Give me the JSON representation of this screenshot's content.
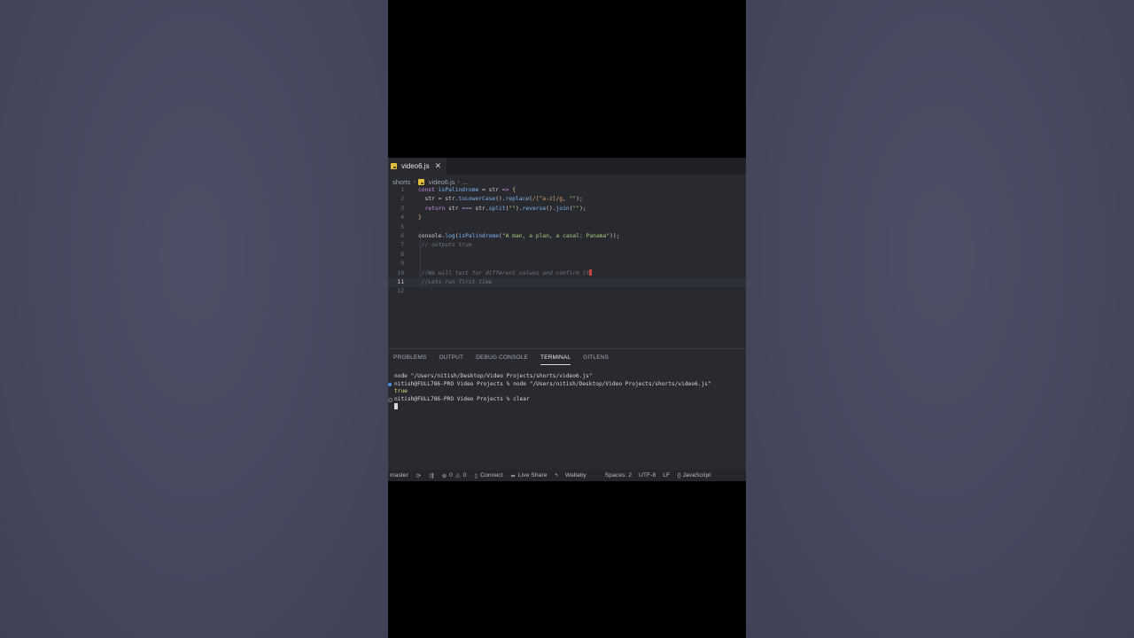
{
  "editor": {
    "tab": {
      "filename": "video6.js",
      "close_glyph": "✕"
    },
    "breadcrumb": [
      "shorts",
      "video6.js",
      "..."
    ],
    "lines": [
      {
        "n": "1",
        "segments": [
          [
            "kw",
            "const "
          ],
          [
            "fn",
            "isPalindrome"
          ],
          [
            "op",
            " = str "
          ],
          [
            "kw",
            "=>"
          ],
          [
            "op",
            " "
          ],
          [
            "brace",
            "{"
          ]
        ]
      },
      {
        "n": "2",
        "segments": [
          [
            "op",
            "  str = str."
          ],
          [
            "fn",
            "toLowerCase"
          ],
          [
            "op",
            "()."
          ],
          [
            "fn",
            "replace"
          ],
          [
            "op",
            "("
          ],
          [
            "rx",
            "/[^a-z]/g"
          ],
          [
            "op",
            ", "
          ],
          [
            "str",
            "\"\""
          ],
          [
            "op",
            ");"
          ]
        ]
      },
      {
        "n": "3",
        "segments": [
          [
            "kw",
            "  return "
          ],
          [
            "op",
            "str "
          ],
          [
            "kw",
            "==="
          ],
          [
            "op",
            " str."
          ],
          [
            "fn",
            "split"
          ],
          [
            "op",
            "("
          ],
          [
            "str",
            "\"\""
          ],
          [
            "op",
            ")."
          ],
          [
            "fn",
            "reverse"
          ],
          [
            "op",
            "()."
          ],
          [
            "fn",
            "join"
          ],
          [
            "op",
            "("
          ],
          [
            "str",
            "\"\""
          ],
          [
            "op",
            ");"
          ]
        ]
      },
      {
        "n": "4",
        "segments": [
          [
            "brace",
            "}"
          ]
        ]
      },
      {
        "n": "5",
        "segments": []
      },
      {
        "n": "6",
        "segments": [
          [
            "op",
            "console."
          ],
          [
            "fn",
            "log"
          ],
          [
            "op",
            "("
          ],
          [
            "fn",
            "isPalindrome"
          ],
          [
            "op",
            "("
          ],
          [
            "str",
            "\"A man, a plan, a canal: Panama\""
          ],
          [
            "op",
            "));"
          ]
        ]
      },
      {
        "n": "7",
        "segments": [
          [
            "cm",
            " // outputs true"
          ]
        ]
      },
      {
        "n": "8",
        "segments": []
      },
      {
        "n": "9",
        "segments": []
      },
      {
        "n": "10",
        "segments": [
          [
            "cm",
            " //We will test for different values and confirm it"
          ]
        ]
      },
      {
        "n": "11",
        "segments": [
          [
            "cm",
            " //Lets run first time"
          ]
        ]
      },
      {
        "n": "12",
        "segments": []
      }
    ],
    "active_line": "11"
  },
  "panel": {
    "tabs": [
      "PROBLEMS",
      "OUTPUT",
      "DEBUG CONSOLE",
      "TERMINAL",
      "GITLENS"
    ],
    "active_tab": "TERMINAL"
  },
  "terminal": {
    "line1": "node \"/Users/nitish/Desktop/Video Projects/shorts/video6.js\"",
    "line2": "nitish@FULL786-PRO Video Projects % node \"/Users/nitish/Desktop/Video Projects/shorts/video6.js\"",
    "line3": "true",
    "line4": "nitish@FULL786-PRO Video Projects % clear"
  },
  "statusbar": {
    "branch": "master",
    "errors": "0",
    "warnings": "0",
    "connect": "Connect",
    "live_share": "Live Share",
    "wallaby": "Wallaby",
    "spaces": "Spaces: 2",
    "encoding": "UTF-8",
    "eol": "LF",
    "language": "JavaScript"
  },
  "colors": {
    "page_background": "#474960",
    "editor_background": "#282a30",
    "js_badge": "#e2c13d",
    "terminal_true": "#e6df7a"
  }
}
